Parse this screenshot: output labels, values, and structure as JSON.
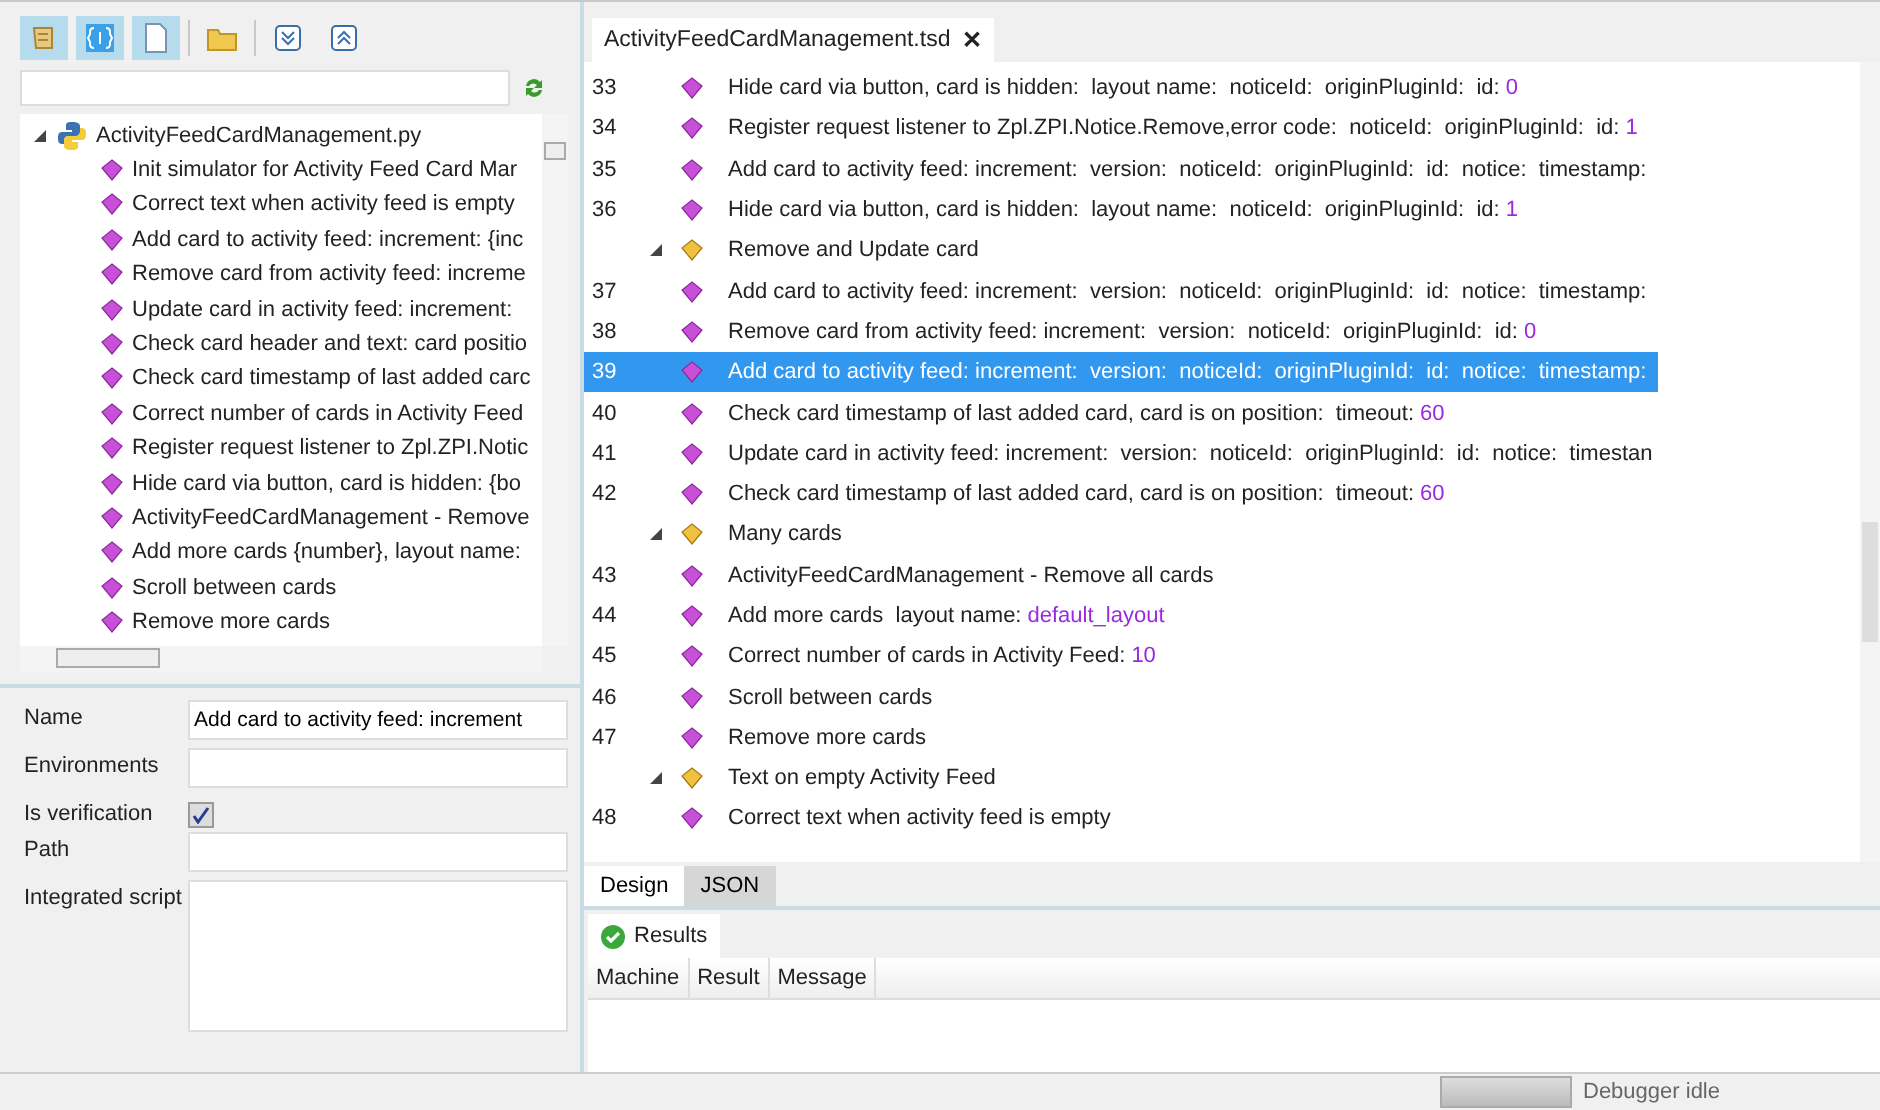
{
  "toolbar": [
    {
      "kind": "script",
      "pressed": true
    },
    {
      "kind": "braces",
      "pressed": true
    },
    {
      "kind": "document",
      "pressed": true
    },
    {
      "kind": "folder",
      "pressed": false
    },
    {
      "kind": "expand",
      "pressed": false
    },
    {
      "kind": "collapse",
      "pressed": false
    }
  ],
  "tree": {
    "label": "ActivityFeedCardManagement.py",
    "expanded": true,
    "children": [
      {
        "label": "Init simulator for Activity Feed Card Mar"
      },
      {
        "label": "Correct text when activity feed is empty"
      },
      {
        "label": "Add card to activity feed: increment: {inc"
      },
      {
        "label": "Remove card from activity feed: increme"
      },
      {
        "label": "Update card in activity feed: increment:"
      },
      {
        "label": "Check card header and text: card positio"
      },
      {
        "label": "Check card timestamp of last added carc"
      },
      {
        "label": "Correct number of cards in Activity Feed"
      },
      {
        "label": "Register request listener to Zpl.ZPI.Notic"
      },
      {
        "label": "Hide card via button, card is hidden: {bo"
      },
      {
        "label": "ActivityFeedCardManagement - Remove"
      },
      {
        "label": "Add more cards {number}, layout name:"
      },
      {
        "label": "Scroll between cards"
      },
      {
        "label": "Remove more cards"
      }
    ]
  },
  "properties": [
    {
      "kind": "text",
      "label": "Name",
      "value": "Add card to activity feed: increment"
    },
    {
      "kind": "text",
      "label": "Environments"
    },
    {
      "kind": "checkbox",
      "label": "Is verification",
      "checked": true
    },
    {
      "kind": "text",
      "label": "Path"
    },
    {
      "kind": "area",
      "label": "Integrated script"
    }
  ],
  "editor": {
    "tab": "ActivityFeedCardManagement.tsd",
    "close": "✕",
    "rows": [
      {
        "kind": "step",
        "number": "33",
        "text": "Hide card via button, card is hidden:  layout name:  noticeId:  originPluginId:  id:",
        "value": "0",
        "selected": false
      },
      {
        "kind": "step",
        "number": "34",
        "text": "Register request listener to Zpl.ZPI.Notice.Remove,error code:  noticeId:  originPluginId:  id:",
        "value": "1",
        "selected": false
      },
      {
        "kind": "step",
        "number": "35",
        "text": "Add card to activity feed: increment:  version:  noticeId:  originPluginId:  id:  notice:  timestamp:",
        "selected": false
      },
      {
        "kind": "step",
        "number": "36",
        "text": "Hide card via button, card is hidden:  layout name:  noticeId:  originPluginId:  id:",
        "value": "1",
        "selected": false
      },
      {
        "kind": "group",
        "text": "Remove and Update card",
        "expanded": true,
        "selected": false
      },
      {
        "kind": "step",
        "number": "37",
        "text": "Add card to activity feed: increment:  version:  noticeId:  originPluginId:  id:  notice:  timestamp:",
        "selected": false
      },
      {
        "kind": "step",
        "number": "38",
        "text": "Remove card from activity feed: increment:  version:  noticeId:  originPluginId:  id:",
        "value": "0",
        "selected": false
      },
      {
        "kind": "step",
        "number": "39",
        "text": "Add card to activity feed: increment:  version:  noticeId:  originPluginId:  id:  notice:  timestamp:",
        "selected": true
      },
      {
        "kind": "step",
        "number": "40",
        "text": "Check card timestamp of last added card, card is on position:  timeout:",
        "value": "60",
        "selected": false
      },
      {
        "kind": "step",
        "number": "41",
        "text": "Update card in activity feed: increment:  version:  noticeId:  originPluginId:  id:  notice:  timestan",
        "selected": false
      },
      {
        "kind": "step",
        "number": "42",
        "text": "Check card timestamp of last added card, card is on position:  timeout:",
        "value": "60",
        "selected": false
      },
      {
        "kind": "group",
        "text": "Many cards",
        "expanded": true,
        "selected": false
      },
      {
        "kind": "step",
        "number": "43",
        "text": "ActivityFeedCardManagement - Remove all cards",
        "selected": false
      },
      {
        "kind": "step",
        "number": "44",
        "text": "Add more cards  layout name:",
        "value": "default_layout",
        "selected": false
      },
      {
        "kind": "step",
        "number": "45",
        "text": "Correct number of cards in Activity Feed:",
        "value": "10",
        "selected": false
      },
      {
        "kind": "step",
        "number": "46",
        "text": "Scroll between cards",
        "selected": false
      },
      {
        "kind": "step",
        "number": "47",
        "text": "Remove more cards",
        "selected": false
      },
      {
        "kind": "group",
        "text": "Text on empty Activity Feed",
        "expanded": true,
        "selected": false
      },
      {
        "kind": "step",
        "number": "48",
        "text": "Correct text when activity feed is empty",
        "selected": false
      }
    ]
  },
  "view_tabs": [
    {
      "label": "Design",
      "selected": true
    },
    {
      "label": "JSON",
      "selected": false
    }
  ],
  "results": {
    "tab": "Results",
    "columns": [
      "Machine",
      "Result",
      "Message"
    ]
  },
  "status_bar": {
    "text": "Debugger idle"
  }
}
